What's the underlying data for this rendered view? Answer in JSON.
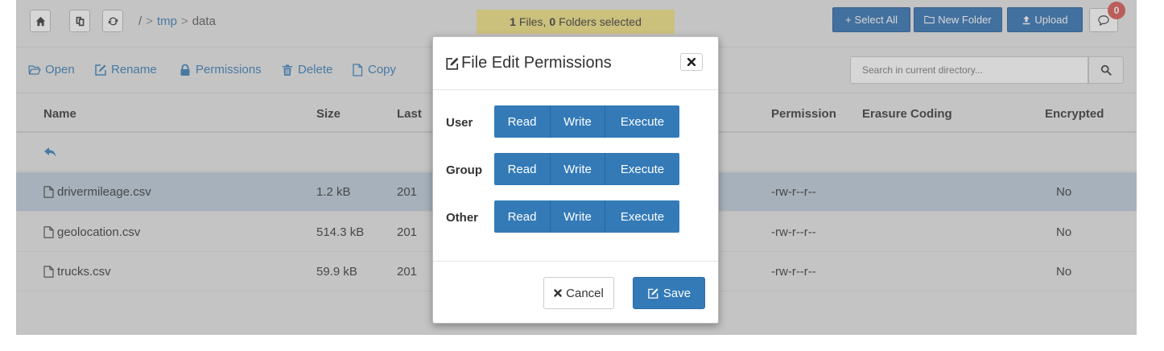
{
  "breadcrumb": {
    "root": "/",
    "sep1": ">",
    "folder1": "tmp",
    "sep2": ">",
    "folder2": "data"
  },
  "selection": {
    "files_count": "1",
    "files_label": "Files,",
    "folders_count": "0",
    "folders_label": "Folders selected"
  },
  "top_actions": {
    "select_all": "Select All",
    "new_folder": "New Folder",
    "upload": "Upload",
    "notifications_count": "0"
  },
  "toolbar": {
    "open": "Open",
    "rename": "Rename",
    "permissions": "Permissions",
    "delete": "Delete",
    "copy": "Copy"
  },
  "search": {
    "placeholder": "Search in current directory..."
  },
  "table": {
    "headers": {
      "name": "Name",
      "size": "Size",
      "last": "Last",
      "permission": "Permission",
      "erasure": "Erasure Coding",
      "encrypted": "Encrypted"
    },
    "rows": [
      {
        "name": "drivermileage.csv",
        "size": "1.2 kB",
        "date": "201",
        "permission": "-rw-r--r--",
        "encrypted": "No",
        "selected": true
      },
      {
        "name": "geolocation.csv",
        "size": "514.3 kB",
        "date": "201",
        "permission": "-rw-r--r--",
        "encrypted": "No",
        "selected": false
      },
      {
        "name": "trucks.csv",
        "size": "59.9 kB",
        "date": "201",
        "permission": "-rw-r--r--",
        "encrypted": "No",
        "selected": false
      }
    ]
  },
  "modal": {
    "title": "File Edit Permissions",
    "groups": [
      {
        "label": "User",
        "read": "Read",
        "write": "Write",
        "execute": "Execute"
      },
      {
        "label": "Group",
        "read": "Read",
        "write": "Write",
        "execute": "Execute"
      },
      {
        "label": "Other",
        "read": "Read",
        "write": "Write",
        "execute": "Execute"
      }
    ],
    "cancel": "Cancel",
    "save": "Save"
  },
  "colors": {
    "primary": "#337ab7",
    "selected_row": "#bccad8",
    "selection_info": "#f0e07f",
    "badge": "#d9534f"
  }
}
